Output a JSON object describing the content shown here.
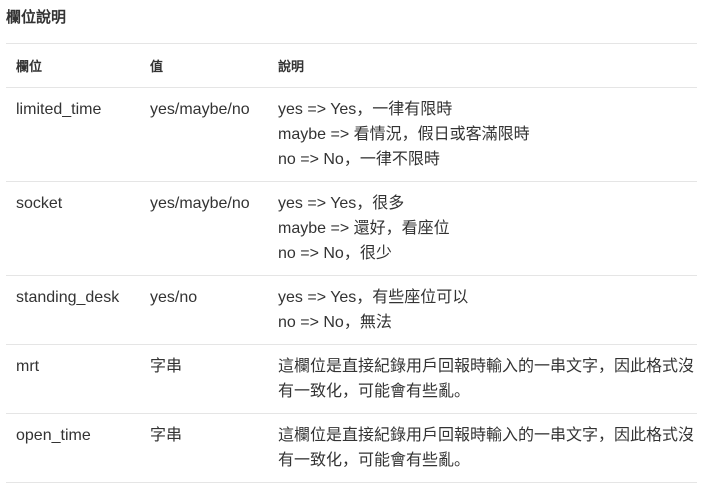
{
  "heading": "欄位說明",
  "columns": [
    "欄位",
    "值",
    "說明"
  ],
  "rows": [
    {
      "field": "limited_time",
      "value": "yes/maybe/no",
      "desc": [
        "yes => Yes，一律有限時",
        "maybe => 看情況，假日或客滿限時",
        "no => No，一律不限時"
      ]
    },
    {
      "field": "socket",
      "value": "yes/maybe/no",
      "desc": [
        "yes => Yes，很多",
        "maybe => 還好，看座位",
        "no => No，很少"
      ]
    },
    {
      "field": "standing_desk",
      "value": "yes/no",
      "desc": [
        "yes => Yes，有些座位可以",
        "no => No，無法"
      ]
    },
    {
      "field": "mrt",
      "value": "字串",
      "desc": [
        "這欄位是直接紀錄用戶回報時輸入的一串文字，因此格式沒有一致化，可能會有些亂。"
      ]
    },
    {
      "field": "open_time",
      "value": "字串",
      "desc": [
        "這欄位是直接紀錄用戶回報時輸入的一串文字，因此格式沒有一致化，可能會有些亂。"
      ]
    }
  ]
}
